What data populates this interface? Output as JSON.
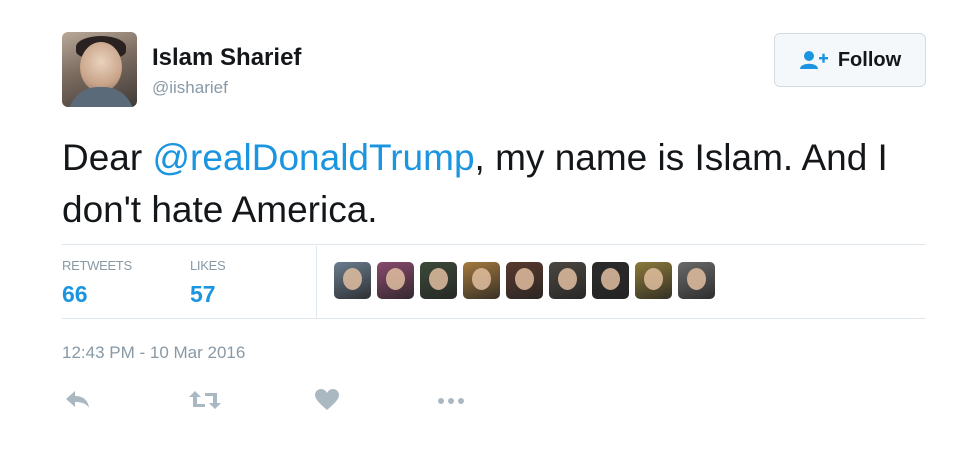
{
  "user": {
    "display_name": "Islam Sharief",
    "handle": "@iisharief"
  },
  "follow_button": {
    "label": "Follow",
    "icon": "user-plus-icon"
  },
  "tweet": {
    "text_before": "Dear ",
    "mention": "@realDonaldTrump",
    "text_after": ", my name is Islam. And I don't hate America."
  },
  "stats": {
    "retweets_label": "RETWEETS",
    "retweets_value": "66",
    "likes_label": "LIKES",
    "likes_value": "57"
  },
  "likers": [
    {
      "icon": "liker-avatar",
      "color": "#6b7d8f"
    },
    {
      "icon": "liker-avatar",
      "color": "#8a4a6e"
    },
    {
      "icon": "liker-avatar",
      "color": "#3c4a3a"
    },
    {
      "icon": "liker-avatar",
      "color": "#a57a3e"
    },
    {
      "icon": "liker-avatar",
      "color": "#5a3a2e"
    },
    {
      "icon": "liker-avatar",
      "color": "#4b4640"
    },
    {
      "icon": "liker-avatar",
      "color": "#2b2b2b"
    },
    {
      "icon": "liker-avatar",
      "color": "#8c7a3a"
    },
    {
      "icon": "liker-avatar",
      "color": "#6a6a6a"
    }
  ],
  "timestamp": "12:43 PM - 10 Mar 2016",
  "actions": [
    "reply-icon",
    "retweet-icon",
    "like-heart-icon",
    "more-icon"
  ],
  "colors": {
    "link": "#1b95e0",
    "muted": "#8899a6",
    "text": "#14171a",
    "divider": "#e1e8ed"
  }
}
